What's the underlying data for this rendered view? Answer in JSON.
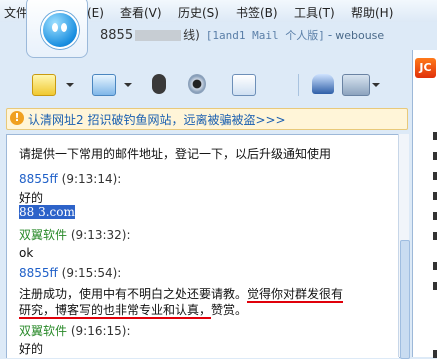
{
  "menu": {
    "items": [
      "文件",
      "编辑(E)",
      "查看(V)",
      "历史(S)",
      "书签(B)",
      "工具(T)",
      "帮助(H)"
    ]
  },
  "buddy": {
    "name": "8855",
    "status": "线)",
    "signature": "[1and1 Mail 个人版]",
    "separator": "-",
    "url": "webouse"
  },
  "warning": {
    "icon": "!",
    "text": "认清网址2 招识破钓鱼网站，远离被骗被盗>>>"
  },
  "side_ad": {
    "badge": "JC"
  },
  "chat": {
    "messages": [
      {
        "text": "请提供一下常用的邮件地址，登记一下，以后升级通知使用"
      },
      {
        "sender": "8855ff",
        "time": "(9:13:14):",
        "text": "好的",
        "email": "88                3.com"
      },
      {
        "sender": "双翼软件",
        "time": "(9:13:32):",
        "text": "ok"
      },
      {
        "sender": "8855ff",
        "time": "(9:15:54):",
        "line1a": "注册成功，使用中有不明白之处还要请教。",
        "line1b": "觉得你对群发很有",
        "line2a": "研究，博客写的也非常专业和认真，",
        "line2b": "赞赏。"
      },
      {
        "sender": "双翼软件",
        "time": "(9:16:15):",
        "text": "好的"
      }
    ]
  },
  "colors": {
    "sender_blue": "#1f60c8",
    "sender_green": "#2a8a2a",
    "highlight": "#e0000a"
  }
}
